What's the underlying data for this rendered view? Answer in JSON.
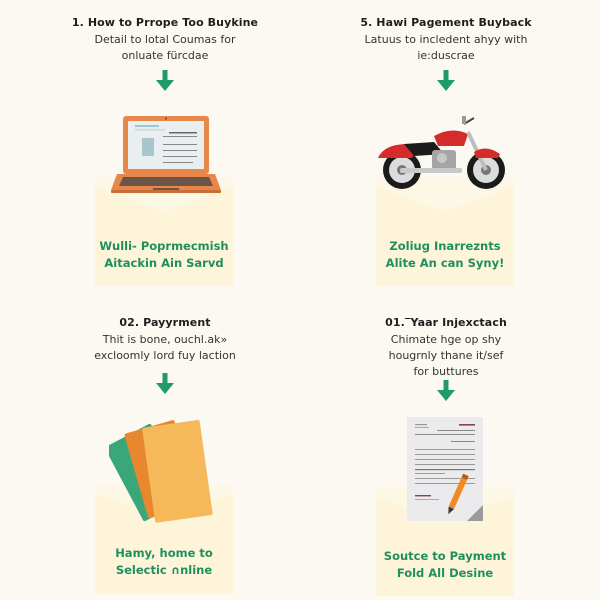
{
  "colors": {
    "background": "#fbf9f2",
    "envelope": "#fdf4d9",
    "accent_green": "#1f9a68",
    "caption_green": "#1f8f5f"
  },
  "steps": [
    {
      "title": "1. How to Prrope Too Buykine",
      "description": [
        "Detail to lotal Coumas for",
        "onluate fürcdae"
      ],
      "icon": "laptop-icon",
      "caption": [
        "Wulli- Poprmecmish",
        "Aitackin Ain Sarvd"
      ]
    },
    {
      "title": "5. Hawi Pagement Buyback",
      "description": [
        "Latuus to incledent ahyy with",
        "ie:duscrae"
      ],
      "icon": "motorcycle-icon",
      "caption": [
        "Zoliug Inarreznts",
        "Alite An can Syny!"
      ]
    },
    {
      "title": "02. Payyrment",
      "description": [
        "Thit is bone, ouchl.ak»",
        "excloomly lord fuy laction"
      ],
      "icon": "cards-icon",
      "caption": [
        "Hamy, home to",
        "Selectic ∩nline"
      ]
    },
    {
      "title": "01.‾Yaar Injexctach",
      "description": [
        "Chimate hge op shy",
        "hougrnly thane it/sef",
        "for buttures"
      ],
      "icon": "document-pen-icon",
      "caption": [
        "Soutce to Payment",
        "Fold All Desine"
      ]
    }
  ]
}
